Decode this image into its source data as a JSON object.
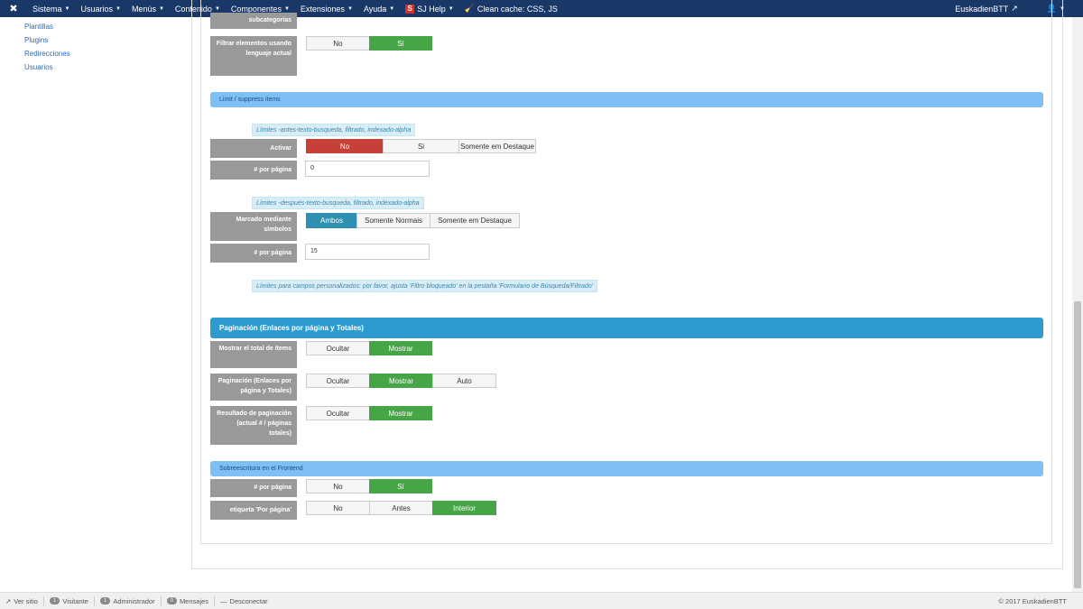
{
  "topbar": {
    "menu": [
      {
        "label": "Sistema",
        "caret": true
      },
      {
        "label": "Usuarios",
        "caret": true
      },
      {
        "label": "Menús",
        "caret": true
      },
      {
        "label": "Contenido",
        "caret": true
      },
      {
        "label": "Componentes",
        "caret": true
      },
      {
        "label": "Extensiones",
        "caret": true
      },
      {
        "label": "Ayuda",
        "caret": true
      }
    ],
    "sj_help": "SJ Help",
    "clean_cache": "Clean cache: CSS, JS",
    "user": "EuskadienBTT",
    "colors": {
      "bar": "#1a3867"
    }
  },
  "sidebar": {
    "items": [
      "Plantillas",
      "Plugins",
      "Redirecciones",
      "Usuarios"
    ]
  },
  "form": {
    "subcat_label": "subcategorías",
    "filter_label": "Filtrar elementos usando lenguaje actual",
    "filter_no": "No",
    "filter_si": "Sí",
    "sec_limit": "Limit / suppress items",
    "note_before": "Límites -antes-texto-busqueda, filtrado, indexado-alpha",
    "activar_label": "Activar",
    "activar_opts": [
      "No",
      "Si",
      "Somente em Destaque"
    ],
    "por_pagina_label": "# por página",
    "por_pagina_val1": "0",
    "note_after": "Límites -después-texto-busqueda, filtrado, indexado-alpha",
    "marcado_label": "Marcado mediante símbolos",
    "marcado_opts": [
      "Ambos",
      "Somente Normais",
      "Somente em Destaque"
    ],
    "por_pagina_val2": "15",
    "note_custom": "Límites para campos personalizados: por favor, ajusta 'Filtro bloqueado' en la pestaña 'Formulario de Búsqueda/Filtrado'",
    "sec_pag": "Paginación (Enlaces por página y Totales)",
    "mostrar_total_label": "Mostrar el total de ítems",
    "ocultar": "Ocultar",
    "mostrar": "Mostrar",
    "auto": "Auto",
    "paginacion_label": "Paginación (Enlaces por página y Totales)",
    "resultado_label": "Resultado de paginación (actual # / páginas totales)",
    "sec_front": "Sobreescritura en el Frontend",
    "front_por_pagina_label": "# por página",
    "etiqueta_label": "etiqueta 'Por página'",
    "no": "No",
    "si": "Sí",
    "antes": "Antes",
    "interior": "Interior"
  },
  "footer": {
    "ver_sitio": "Ver sitio",
    "visitante_count": "1",
    "visitante": "Visitante",
    "admin_count": "1",
    "admin": "Administrador",
    "msg_count": "0",
    "mensajes": "Mensajes",
    "desconectar": "Desconectar",
    "copyright": "© 2017 EuskadienBTT"
  }
}
